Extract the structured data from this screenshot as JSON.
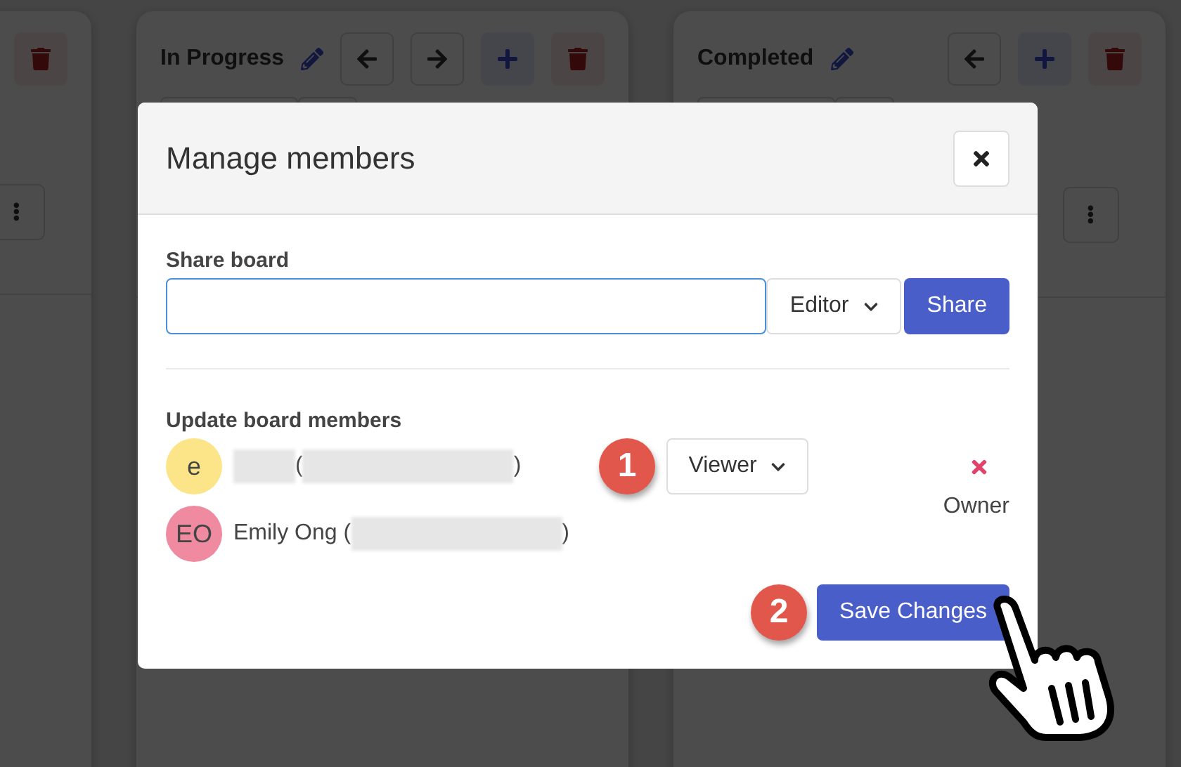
{
  "board": {
    "columns": [
      {
        "actions": [
          {
            "kind": "delete"
          }
        ]
      },
      {
        "title": "In Progress",
        "actions": [
          {
            "kind": "left"
          },
          {
            "kind": "right"
          },
          {
            "kind": "add"
          },
          {
            "kind": "delete"
          }
        ]
      },
      {
        "title": "Completed",
        "actions": [
          {
            "kind": "left"
          },
          {
            "kind": "add"
          },
          {
            "kind": "delete"
          }
        ]
      }
    ]
  },
  "modal": {
    "title": "Manage members",
    "share": {
      "label": "Share board",
      "role": "Editor",
      "button": "Share"
    },
    "members_heading": "Update board members",
    "members": [
      {
        "initials": "e",
        "color": "#fce588",
        "parts": [
          {
            "kind": "redacted-short"
          },
          {
            "kind": "text",
            "text": "("
          },
          {
            "kind": "redacted-long"
          },
          {
            "kind": "text",
            "text": ")"
          }
        ],
        "step": "1",
        "role": {
          "kind": "select",
          "text": "Viewer"
        },
        "actions": [
          {
            "kind": "remove"
          }
        ]
      },
      {
        "initials": "EO",
        "color": "#ef8aa0",
        "parts": [
          {
            "kind": "text",
            "text": "Emily Ong ("
          },
          {
            "kind": "redacted-long"
          },
          {
            "kind": "text",
            "text": ")"
          }
        ],
        "role": {
          "kind": "label",
          "text": "Owner"
        }
      }
    ],
    "save": {
      "step": "2",
      "label": "Save Changes"
    }
  }
}
